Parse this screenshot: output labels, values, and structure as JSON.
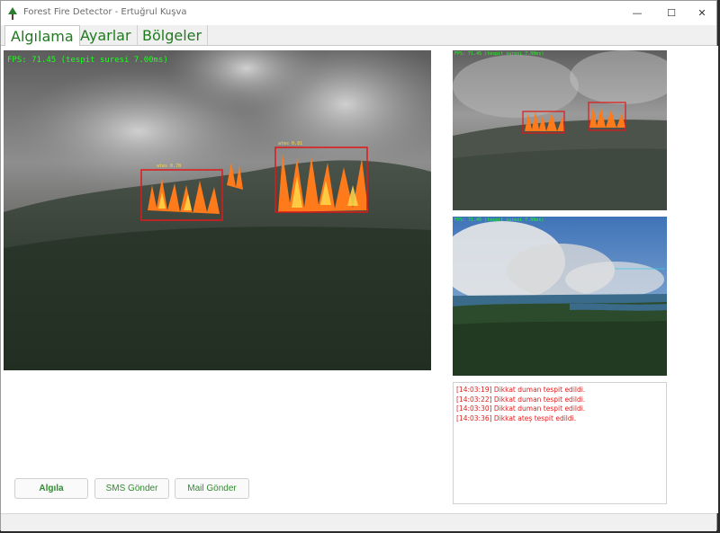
{
  "window": {
    "title": "Forest Fire Detector - Ertuğrul Kuşva",
    "controls": {
      "minimize": "—",
      "maximize": "☐",
      "close": "✕"
    }
  },
  "tabs": [
    {
      "label": "Algılama",
      "active": true
    },
    {
      "label": "Ayarlar",
      "active": false
    },
    {
      "label": "Bölgeler",
      "active": false
    }
  ],
  "main_feed": {
    "fps_text": "FPS: 71.45 (tespit suresi 7.00ms)",
    "detections": [
      {
        "label": "ates 0.78"
      },
      {
        "label": "ates 0.81"
      }
    ]
  },
  "side_feeds": [
    {
      "fps_text": "FPS: 71.45 (tespit suresi 7.00ms)"
    },
    {
      "fps_text": "FPS: 71.45 (tespit suresi 7.00ms)"
    }
  ],
  "log": [
    "[14:03:19] Dikkat duman tespit edildi.",
    "[14:03:22] Dikkat duman tespit edildi.",
    "[14:03:30] Dikkat duman tespit edildi.",
    "[14:03:36] Dikkat ateş tespit edildi."
  ],
  "buttons": {
    "detect": "Algıla",
    "sms": "SMS Gönder",
    "mail": "Mail Gönder"
  },
  "colors": {
    "accent_green": "#1f7a1f",
    "detection_box": "#e01818",
    "log_text": "#e02020",
    "overlay_text": "#1bff1b"
  }
}
